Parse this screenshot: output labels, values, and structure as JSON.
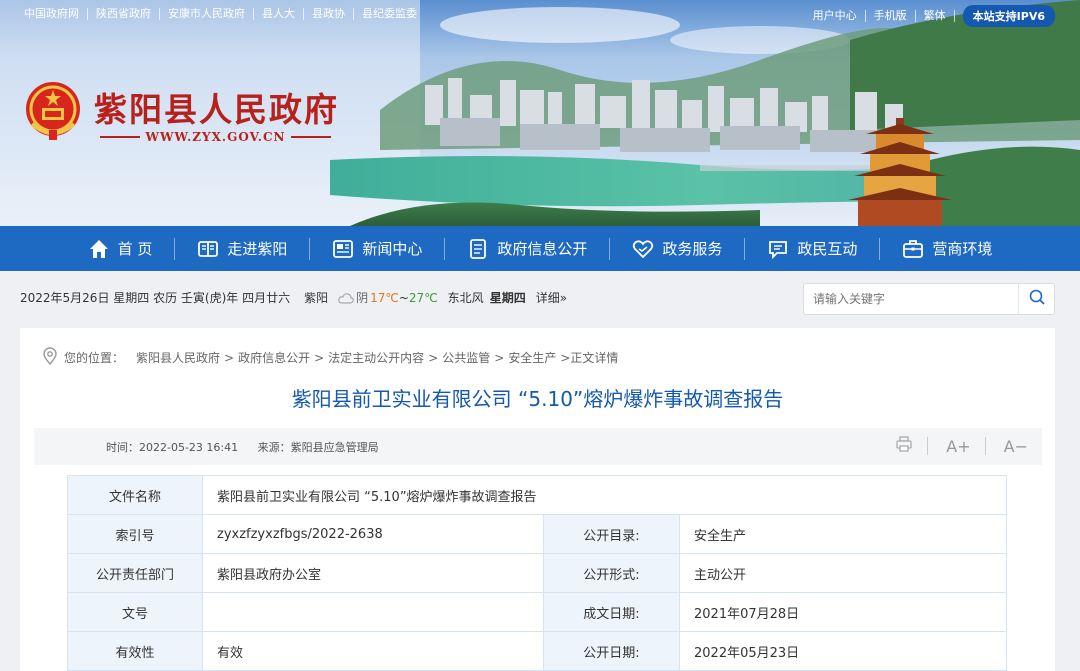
{
  "top_links": [
    "中国政府网",
    "陕西省政府",
    "安康市人民政府",
    "县人大",
    "县政协",
    "县纪委监委"
  ],
  "top_right_links": [
    "用户中心",
    "手机版",
    "繁体"
  ],
  "ipv6_badge": "本站支持IPV6",
  "site": {
    "name": "紫阳县人民政府",
    "url": "WWW.ZYX.GOV.CN"
  },
  "nav": [
    {
      "label": "首 页",
      "icon": "home-icon"
    },
    {
      "label": "走进紫阳",
      "icon": "book-icon"
    },
    {
      "label": "新闻中心",
      "icon": "news-icon"
    },
    {
      "label": "政府信息公开",
      "icon": "document-icon"
    },
    {
      "label": "政务服务",
      "icon": "heart-hand-icon"
    },
    {
      "label": "政民互动",
      "icon": "chat-icon"
    },
    {
      "label": "营商环境",
      "icon": "briefcase-icon"
    }
  ],
  "info": {
    "date": "2022年5月26日 星期四 农历 壬寅(虎)年 四月廿六",
    "city": "紫阳",
    "weather": "阴",
    "temp_low": "17℃",
    "temp_sep": "~",
    "temp_high": "27℃",
    "wind": "东北风",
    "weekday": "星期四",
    "detail": "详细»"
  },
  "search": {
    "placeholder": "请输入关键字"
  },
  "breadcrumb": {
    "label": "您的位置：",
    "items": [
      "紫阳县人民政府",
      "政府信息公开",
      "法定主动公开内容",
      "公共监管",
      "安全生产"
    ],
    "separator": ">",
    "current": ">正文详情"
  },
  "article": {
    "title": "紫阳县前卫实业有限公司 “5.10”熔炉爆炸事故调查报告",
    "time_label": "时间：",
    "time": "2022-05-23 16:41",
    "source_label": "来源：",
    "source": "紫阳县应急管理局",
    "font_up": "A+",
    "font_down": "A−"
  },
  "info_table": {
    "file_name_label": "文件名称",
    "file_name": "紫阳县前卫实业有限公司 “5.10”熔炉爆炸事故调查报告",
    "index_label": "索引号",
    "index": "zyxzfzyxzfbgs/2022-2638",
    "catalog_label": "公开目录:",
    "catalog": "安全生产",
    "dept_label": "公开责任部门",
    "dept": "紫阳县政府办公室",
    "form_label": "公开形式:",
    "form": "主动公开",
    "doc_no_label": "文号",
    "doc_no": "",
    "written_date_label": "成文日期:",
    "written_date": "2021年07月28日",
    "validity_label": "有效性",
    "validity": "有效",
    "publish_date_label": "公开日期:",
    "publish_date": "2022年05月23日"
  }
}
